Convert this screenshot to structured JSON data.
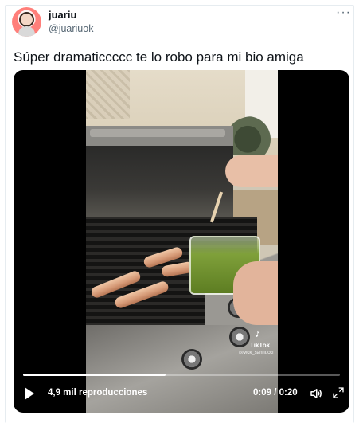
{
  "tweet": {
    "display_name": "juariu",
    "handle": "@juariuok",
    "text": "Súper dramaticcccc te lo robo para mi bio amiga",
    "more_icon": "more-icon"
  },
  "video": {
    "views": "4,9 mil reproducciones",
    "time": "0:09 / 0:20",
    "progress": 0.45,
    "watermark": "TikTok",
    "watermark_user": "@vick_sannucci"
  },
  "icons": {
    "play": "play-icon",
    "volume": "volume-icon",
    "fullscreen": "fullscreen-icon"
  }
}
